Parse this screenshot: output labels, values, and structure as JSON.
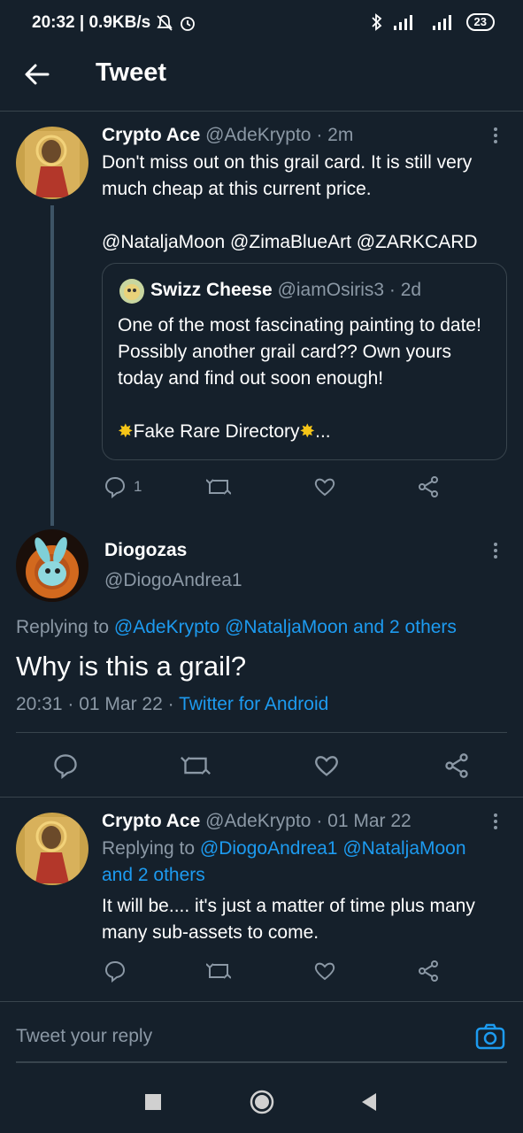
{
  "status": {
    "time_speed": "20:32 | 0.9KB/s",
    "battery": "23"
  },
  "header": {
    "title": "Tweet"
  },
  "tweet1": {
    "name": "Crypto Ace",
    "handle": "@AdeKrypto",
    "time": "· 2m",
    "text": "Don't miss out on this grail card. It is still very much cheap at this current price.",
    "mentions": "@NataljaMoon @ZimaBlueArt @ZARKCARD",
    "reply_count": "1",
    "quote": {
      "name": "Swizz Cheese",
      "handle": "@iamOsiris3",
      "time": "· 2d",
      "text": "One of the most fascinating painting to date! Possibly another grail card?? Own yours today and find out soon enough!",
      "footer": "Fake Rare Directory",
      "ellipsis": "..."
    }
  },
  "main_tweet": {
    "name": "Diogozas",
    "handle": "@DiogoAndrea1",
    "replying_label": "Replying to",
    "replying_to": "@AdeKrypto @NataljaMoon and 2 others",
    "text": "Why is this a grail?",
    "timestamp": "20:31 · 01 Mar 22 ·",
    "source": "Twitter for Android"
  },
  "reply": {
    "name": "Crypto Ace",
    "handle": "@AdeKrypto",
    "time": "· 01 Mar 22",
    "replying_label": "Replying to",
    "replying_to_1": "@DiogoAndrea1 @NataljaMoon",
    "replying_to_2": "and 2 others",
    "text": "It will be.... it's just a matter of time plus many many sub-assets to come."
  },
  "composer": {
    "placeholder": "Tweet your reply"
  },
  "colors": {
    "background": "#15202b",
    "accent": "#1d9bf0",
    "muted": "#8b98a5",
    "border": "#38444d"
  }
}
